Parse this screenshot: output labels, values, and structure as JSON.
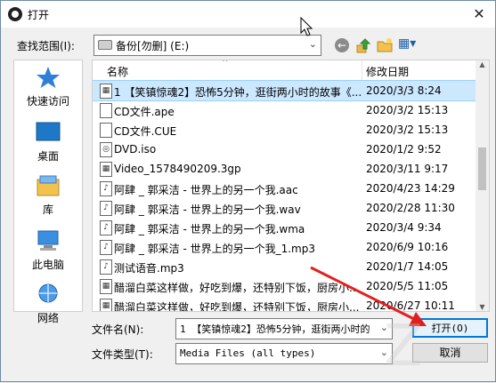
{
  "window": {
    "title": "打开",
    "close_glyph": "✕"
  },
  "toolbar": {
    "lookin_label": "查找范围(I):",
    "lookin_value": "备份[勿删] (E:)",
    "back_glyph": "←",
    "view_glyph": "▦▾"
  },
  "sidebar": {
    "items": [
      {
        "label": "快速访问",
        "icon": "star-icon"
      },
      {
        "label": "桌面",
        "icon": "desktop-icon"
      },
      {
        "label": "库",
        "icon": "library-icon"
      },
      {
        "label": "此电脑",
        "icon": "computer-icon"
      },
      {
        "label": "网络",
        "icon": "network-icon"
      }
    ]
  },
  "filelist": {
    "col_name": "名称",
    "col_date": "修改日期",
    "sort_glyph": "^",
    "rows": [
      {
        "name": "1 【笑镇惊魂2】恐怖5分钟，逛街两小时的故事《...",
        "date": "2020/3/3 8:24",
        "icon": "video-file-icon",
        "selected": true
      },
      {
        "name": "CD文件.ape",
        "date": "2020/3/2 15:13",
        "icon": "file-icon"
      },
      {
        "name": "CD文件.CUE",
        "date": "2020/3/2 15:13",
        "icon": "file-icon"
      },
      {
        "name": "DVD.iso",
        "date": "2020/1/2 9:52",
        "icon": "disc-file-icon"
      },
      {
        "name": "Video_1578490209.3gp",
        "date": "2020/3/11 9:17",
        "icon": "video-file-icon"
      },
      {
        "name": "阿肆 _ 郭采洁 - 世界上的另一个我.aac",
        "date": "2020/4/23 14:29",
        "icon": "audio-file-icon"
      },
      {
        "name": "阿肆 _ 郭采洁 - 世界上的另一个我.wav",
        "date": "2020/2/28 11:30",
        "icon": "audio-file-icon"
      },
      {
        "name": "阿肆 _ 郭采洁 - 世界上的另一个我.wma",
        "date": "2020/3/4 9:34",
        "icon": "audio-file-icon"
      },
      {
        "name": "阿肆 _ 郭采洁 - 世界上的另一个我_1.mp3",
        "date": "2020/6/9 10:16",
        "icon": "audio-file-icon"
      },
      {
        "name": "测试语音.mp3",
        "date": "2020/1/7 14:05",
        "icon": "audio-file-icon"
      },
      {
        "name": "醋溜白菜这样做，好吃到爆，还特别下饭，厨房小...",
        "date": "2020/5/5 11:05",
        "icon": "video-file-icon"
      },
      {
        "name": "醋溜白菜这样做，好吃到爆，还特别下饭，厨房小...",
        "date": "2020/6/27 10:11",
        "icon": "video-file-icon"
      }
    ]
  },
  "footer": {
    "filename_label": "文件名(N):",
    "filename_value": "1 【笑镇惊魂2】恐怖5分钟，逛街两小时的",
    "filetype_label": "文件类型(T):",
    "filetype_value": "Media Files (all types)",
    "open_label": "打开(O)",
    "cancel_label": "取消"
  },
  "colors": {
    "accent": "#0078d7",
    "selection": "#cce8ff",
    "annotation_arrow": "#e02020"
  }
}
